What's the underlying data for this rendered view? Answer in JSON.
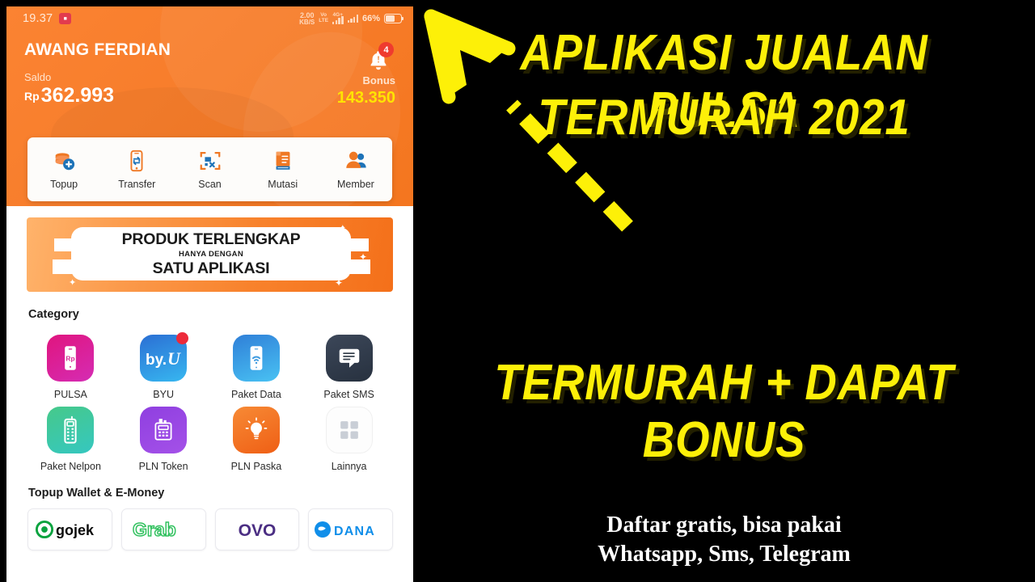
{
  "phone": {
    "status_bar": {
      "time": "19.37",
      "recording_badge": "REC",
      "data_rate_value": "2.00",
      "data_rate_unit": "KB/S",
      "volte_top": "Vo",
      "volte_bottom": "LTE",
      "network_top": "4G+",
      "battery_percent": "66%"
    },
    "header": {
      "user_name": "AWANG FERDIAN",
      "notification_count": "4",
      "saldo_label": "Saldo",
      "saldo_currency": "Rp",
      "saldo_amount": "362.993",
      "bonus_label": "Bonus",
      "bonus_amount": "143.350",
      "bg_color": "#f77d2b"
    },
    "quick_actions": [
      {
        "label": "Topup",
        "icon": "coins-plus-icon"
      },
      {
        "label": "Transfer",
        "icon": "phone-transfer-icon"
      },
      {
        "label": "Scan",
        "icon": "qr-scan-icon"
      },
      {
        "label": "Mutasi",
        "icon": "ledger-book-icon"
      },
      {
        "label": "Member",
        "icon": "members-icon"
      }
    ],
    "banner": {
      "line1": "PRODUK TERLENGKAP",
      "line2": "HANYA DENGAN",
      "line3": "SATU APLIKASI"
    },
    "category_section_title": "Category",
    "categories": [
      {
        "label": "PULSA",
        "icon": "pulsa-icon",
        "badge": ""
      },
      {
        "label": "BYU",
        "icon": "byu-logo-icon",
        "badge": "dot"
      },
      {
        "label": "Paket Data",
        "icon": "paket-data-icon",
        "badge": ""
      },
      {
        "label": "Paket SMS",
        "icon": "paket-sms-icon",
        "badge": ""
      },
      {
        "label": "Paket Nelpon",
        "icon": "paket-nelpon-icon",
        "badge": ""
      },
      {
        "label": "PLN Token",
        "icon": "pln-token-icon",
        "badge": ""
      },
      {
        "label": "PLN Paska",
        "icon": "pln-paska-icon",
        "badge": ""
      },
      {
        "label": "Lainnya",
        "icon": "lainnya-grid-icon",
        "badge": ""
      }
    ],
    "wallet_section_title": "Topup Wallet & E-Money",
    "wallets": [
      {
        "label": "gojek",
        "icon": "gojek-logo-icon"
      },
      {
        "label": "Grab",
        "icon": "grab-logo-icon"
      },
      {
        "label": "OVO",
        "icon": "ovo-logo-icon"
      },
      {
        "label": "DANA",
        "icon": "dana-logo-icon"
      }
    ]
  },
  "promo": {
    "title_line1": "APLIKASI JUALAN PULSA",
    "title_line2": "TERMURAH 2021",
    "title_line3": "TERMURAH + DAPAT BONUS",
    "subtitle_line1": "Daftar gratis, bisa pakai",
    "subtitle_line2": "Whatsapp, Sms, Telegram",
    "accent_color": "#fdf008",
    "background_color": "#000000",
    "arrow": "dashed-arrow-up-left-icon"
  }
}
